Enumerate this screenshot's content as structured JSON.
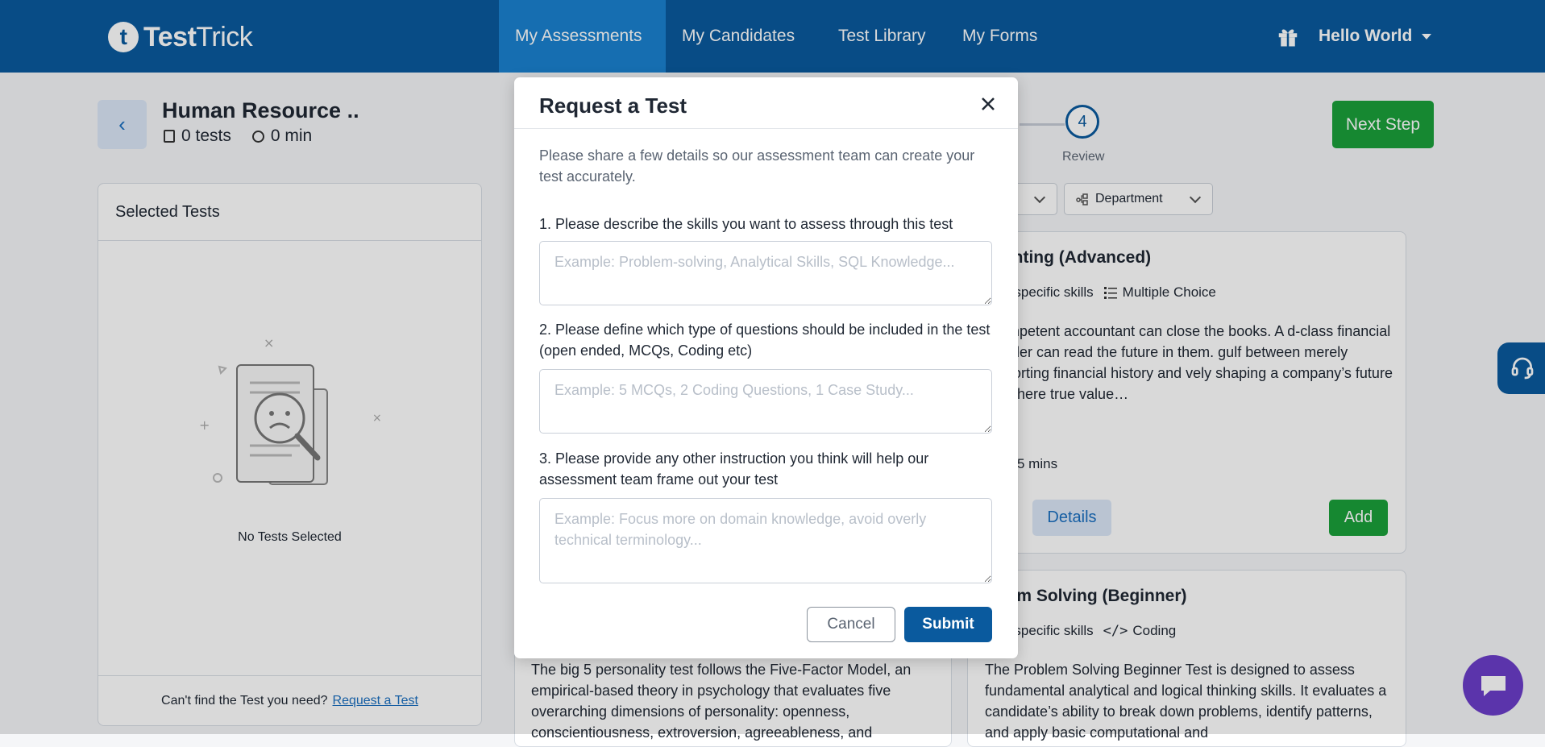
{
  "brand": {
    "logo_letter": "t",
    "name_bold": "Test",
    "name_rest": "Trick"
  },
  "nav": {
    "items": [
      {
        "label": "My Assessments"
      },
      {
        "label": "My Candidates"
      },
      {
        "label": "Test Library"
      },
      {
        "label": "My Forms"
      }
    ],
    "user_label": "Hello World"
  },
  "assessment": {
    "back_icon": "‹",
    "title": "Human Resource ..",
    "tests_count": "0 tests",
    "duration": "0 min"
  },
  "stepper": {
    "step_number": "4",
    "step_label": "Review",
    "next_button": "Next Step"
  },
  "selected_panel": {
    "title": "Selected Tests",
    "empty_text": "No Tests Selected",
    "footer_text": "Can't find the Test you need?",
    "footer_link": "Request a Test"
  },
  "filters": {
    "department": "Department"
  },
  "cards": [
    {
      "title": "ounting (Advanced)",
      "tag_skills": "ple specific skills",
      "tag_type": "Multiple Choice",
      "description": "competent accountant can close the books. A d-class financial leader can read the future in them. gulf between merely reporting financial history and vely shaping a company’s future is where true value…",
      "time": "5 mins",
      "details_label": "Details",
      "add_label": "Add"
    },
    {
      "title": "blem Solving (Beginner)",
      "tag_skills": "ple specific skills",
      "tag_type": "Coding",
      "description": "The Problem Solving Beginner Test is designed to assess fundamental analytical and logical thinking skills. It evaluates a candidate’s ability to break down problems, identify patterns, and apply basic computational and"
    },
    {
      "description": "The big 5 personality test follows the Five-Factor Model, an empirical-based theory in psychology that evaluates five overarching dimensions of personality: openness, conscientiousness, extroversion, agreeableness, and"
    }
  ],
  "modal": {
    "title": "Request a Test",
    "intro": "Please share a few details so our assessment team can create your test accurately.",
    "questions": [
      {
        "label": "1. Please describe the skills you want to assess through this test",
        "placeholder": "Example: Problem-solving, Analytical Skills, SQL Knowledge..."
      },
      {
        "label": "2. Please define which type of questions should be included in the test (open ended, MCQs, Coding etc)",
        "placeholder": "Example: 5 MCQs, 2 Coding Questions, 1 Case Study..."
      },
      {
        "label": "3. Please provide any other instruction you think will help our assessment team frame out your test",
        "placeholder": "Example: Focus more on domain knowledge, avoid overly technical terminology..."
      }
    ],
    "cancel_label": "Cancel",
    "submit_label": "Submit"
  },
  "colors": {
    "brand": "#0a5a9e",
    "nav_active": "#1a82d0",
    "success": "#1aa03a",
    "chat": "#6c3ec9"
  }
}
